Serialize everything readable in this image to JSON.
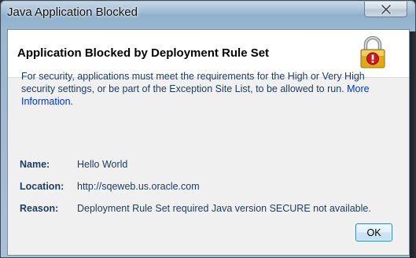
{
  "window": {
    "title": "Java Application Blocked"
  },
  "header": {
    "heading": "Application Blocked by Deployment Rule Set",
    "icon": "lock-warning-icon"
  },
  "message": {
    "text": "For security, applications must meet the requirements for the High or Very High security settings, or be part of the Exception Site List, to be allowed to run.",
    "link_text": "More Information."
  },
  "details": [
    {
      "label": "Name:",
      "value": "Hello World"
    },
    {
      "label": "Location:",
      "value": "http://sqeweb.us.oracle.com"
    },
    {
      "label": "Reason:",
      "value": "Deployment Rule Set required Java version SECURE not available."
    }
  ],
  "buttons": {
    "ok_label": "OK"
  },
  "colors": {
    "text": "#1e3a5c",
    "link": "#0033cc",
    "lock_gold": "#e0a81c",
    "warning_red": "#d01a1a"
  }
}
